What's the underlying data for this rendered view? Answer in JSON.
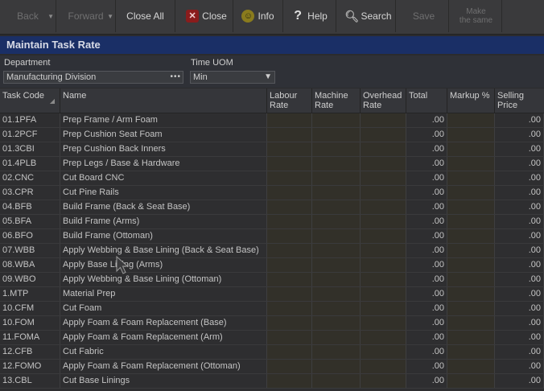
{
  "toolbar": {
    "back": "Back",
    "forward": "Forward",
    "close_all": "Close All",
    "close": "Close",
    "info": "Info",
    "help": "Help",
    "search": "Search",
    "save": "Save",
    "make_same_line1": "Make",
    "make_same_line2": "the same"
  },
  "window_title": "Maintain Task Rate",
  "filters": {
    "department_label": "Department",
    "department_value": "Manufacturing Division",
    "time_uom_label": "Time UOM",
    "time_uom_value": "Min"
  },
  "columns": {
    "task_code": "Task Code",
    "name": "Name",
    "labour_1": "Labour",
    "labour_2": "Rate",
    "machine_1": "Machine",
    "machine_2": "Rate",
    "overhead_1": "Overhead",
    "overhead_2": "Rate",
    "total": "Total",
    "markup": "Markup %",
    "selling_1": "Selling",
    "selling_2": "Price"
  },
  "rows": [
    {
      "code": "01.1PFA",
      "name": "Prep Frame / Arm Foam",
      "total": ".00",
      "price": ".00"
    },
    {
      "code": "01.2PCF",
      "name": "Prep Cushion Seat Foam",
      "total": ".00",
      "price": ".00"
    },
    {
      "code": "01.3CBI",
      "name": "Prep Cushion Back Inners",
      "total": ".00",
      "price": ".00"
    },
    {
      "code": "01.4PLB",
      "name": "Prep Legs / Base & Hardware",
      "total": ".00",
      "price": ".00"
    },
    {
      "code": "02.CNC",
      "name": "Cut Board CNC",
      "total": ".00",
      "price": ".00"
    },
    {
      "code": "03.CPR",
      "name": "Cut Pine Rails",
      "total": ".00",
      "price": ".00"
    },
    {
      "code": "04.BFB",
      "name": "Build Frame (Back & Seat Base)",
      "total": ".00",
      "price": ".00"
    },
    {
      "code": "05.BFA",
      "name": "Build Frame (Arms)",
      "total": ".00",
      "price": ".00"
    },
    {
      "code": "06.BFO",
      "name": "Build Frame (Ottoman)",
      "total": ".00",
      "price": ".00"
    },
    {
      "code": "07.WBB",
      "name": "Apply Webbing & Base Lining (Back & Seat Base)",
      "total": ".00",
      "price": ".00"
    },
    {
      "code": "08.WBA",
      "name": "Apply Base Lining (Arms)",
      "total": ".00",
      "price": ".00"
    },
    {
      "code": "09.WBO",
      "name": "Apply Webbing & Base Lining (Ottoman)",
      "total": ".00",
      "price": ".00"
    },
    {
      "code": "1.MTP",
      "name": "Material Prep",
      "total": ".00",
      "price": ".00"
    },
    {
      "code": "10.CFM",
      "name": "Cut Foam",
      "total": ".00",
      "price": ".00"
    },
    {
      "code": "10.FOM",
      "name": "Apply Foam & Foam Replacement (Base)",
      "total": ".00",
      "price": ".00"
    },
    {
      "code": "11.FOMA",
      "name": "Apply Foam & Foam Replacement (Arm)",
      "total": ".00",
      "price": ".00"
    },
    {
      "code": "12.CFB",
      "name": "Cut Fabric",
      "total": ".00",
      "price": ".00"
    },
    {
      "code": "12.FOMO",
      "name": "Apply Foam & Foam Replacement (Ottoman)",
      "total": ".00",
      "price": ".00"
    },
    {
      "code": "13.CBL",
      "name": "Cut Base Linings",
      "total": ".00",
      "price": ".00"
    }
  ]
}
